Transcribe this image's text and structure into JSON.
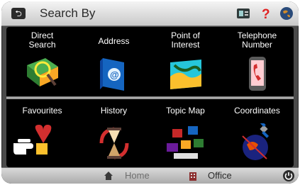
{
  "header": {
    "title": "Search By"
  },
  "tiles": [
    {
      "label": "Direct\nSearch"
    },
    {
      "label": "Address"
    },
    {
      "label": "Point of\nInterest"
    },
    {
      "label": "Telephone\nNumber"
    },
    {
      "label": "Favourites"
    },
    {
      "label": "History"
    },
    {
      "label": "Topic Map"
    },
    {
      "label": "Coordinates"
    }
  ],
  "bottom": {
    "home_label": "Home",
    "office_label": "Office"
  },
  "icons": {
    "back": "back-arrow-icon",
    "card": "card-icon",
    "help": "question-mark-icon",
    "globe": "globe-icon",
    "power": "power-icon"
  },
  "colors": {
    "accent_red": "#e02020",
    "frame": "#4a4a4a",
    "panel": "#000000"
  }
}
